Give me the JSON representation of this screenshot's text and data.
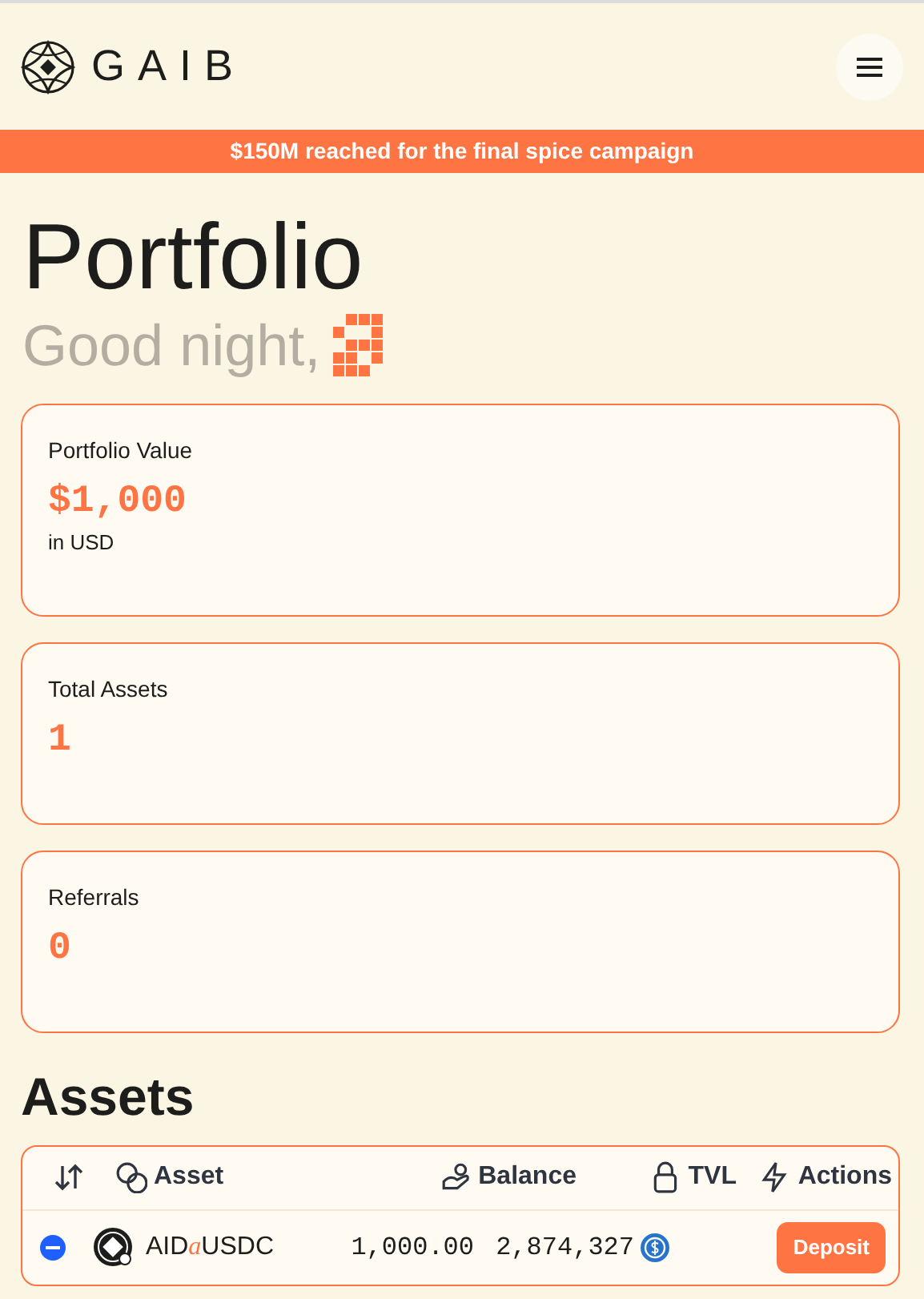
{
  "header": {
    "logo_text": "GAIB"
  },
  "banner": {
    "text": "$150M reached for the final spice campaign"
  },
  "page": {
    "title": "Portfolio",
    "greeting": "Good night,"
  },
  "stats": [
    {
      "label": "Portfolio Value",
      "value": "$1,000",
      "note": "in USD"
    },
    {
      "label": "Total Assets",
      "value": "1"
    },
    {
      "label": "Referrals",
      "value": "0"
    }
  ],
  "assets": {
    "title": "Assets",
    "columns": [
      "Asset",
      "Balance",
      "TVL",
      "Actions"
    ],
    "rows": [
      {
        "asset": {
          "prefix": "AID",
          "infix": "a",
          "suffix": "USDC"
        },
        "balance": "1,000.00",
        "tvl": "2,874,327",
        "action": "Deposit"
      }
    ]
  }
}
